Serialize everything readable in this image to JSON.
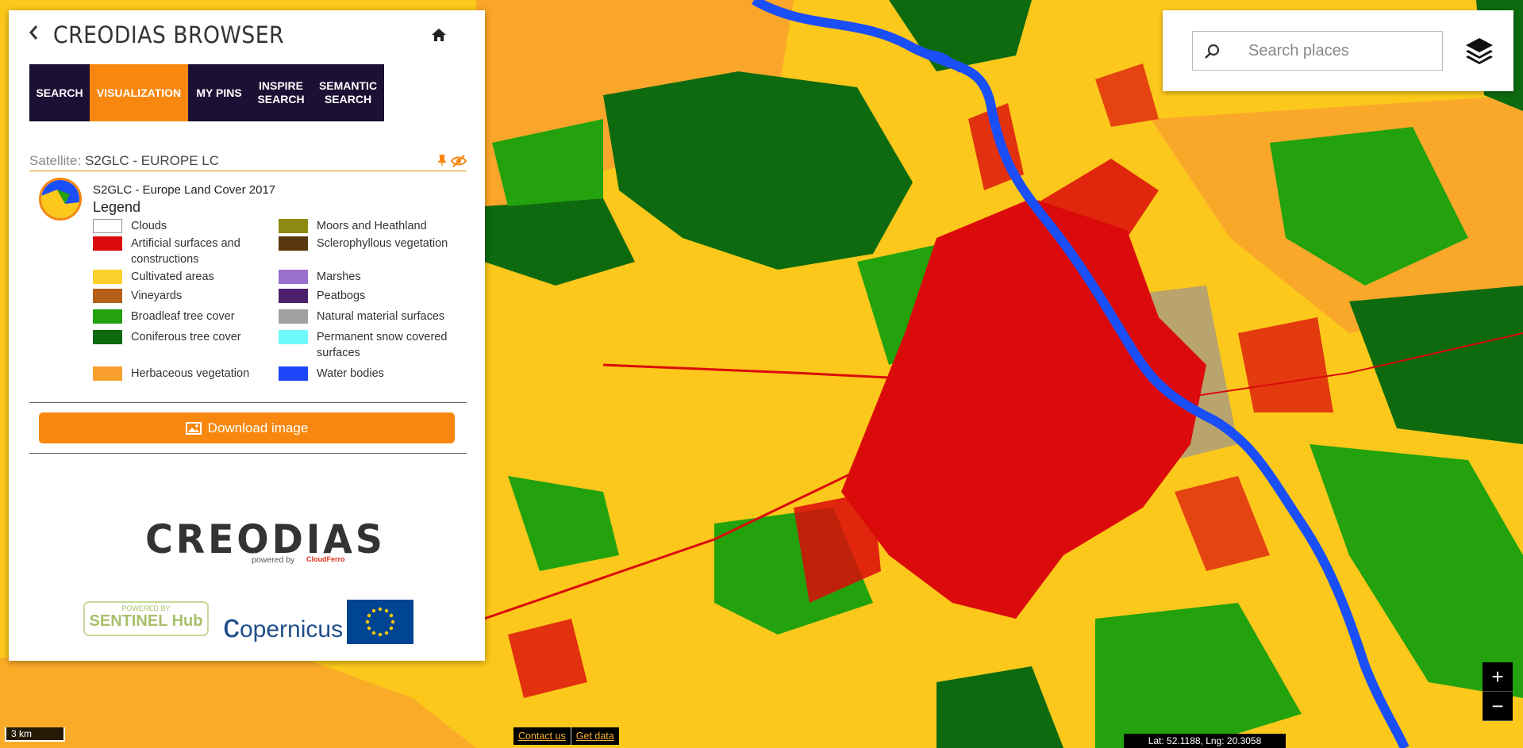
{
  "map": {
    "colors": {
      "cultivated": "#fcc81b",
      "herbaceous": "#f9a02e",
      "broadleaf": "#23a20e",
      "coniferous": "#0d6a0e",
      "artificial": "#db0b0b",
      "water": "#1a4ef7",
      "natural": "#8c8ea4"
    }
  },
  "panel": {
    "title": "CREODIAS BROWSER",
    "tabs": [
      {
        "label": "SEARCH",
        "active": false
      },
      {
        "label": "VISUALIZATION",
        "active": true
      },
      {
        "label": "MY PINS",
        "active": false
      },
      {
        "label": "INSPIRE\nSEARCH",
        "active": false
      },
      {
        "label": "SEMANTIC\nSEARCH",
        "active": false
      }
    ],
    "satellite_label": "Satellite:",
    "satellite_value": "S2GLC - EUROPE LC",
    "layer_title": "S2GLC - Europe Land Cover 2017",
    "legend_title": "Legend",
    "legend": [
      {
        "label": "Clouds",
        "color": "#ffffff"
      },
      {
        "label": "Artificial surfaces and constructions",
        "color": "#db0b0b"
      },
      {
        "label": "Cultivated areas",
        "color": "#fcd12c"
      },
      {
        "label": "Vineyards",
        "color": "#b55f19"
      },
      {
        "label": "Broadleaf tree cover",
        "color": "#23a20e"
      },
      {
        "label": "Coniferous tree cover",
        "color": "#0d6a0e"
      },
      {
        "label": "Herbaceous vegetation",
        "color": "#f9a02e"
      },
      {
        "label": "Moors and Heathland",
        "color": "#8c8a10"
      },
      {
        "label": "Sclerophyllous vegetation",
        "color": "#5b370d"
      },
      {
        "label": "Marshes",
        "color": "#9a6fcd"
      },
      {
        "label": "Peatbogs",
        "color": "#4b1f6b"
      },
      {
        "label": "Natural material surfaces",
        "color": "#a0a0a0"
      },
      {
        "label": "Permanent snow covered surfaces",
        "color": "#6ff9fb"
      },
      {
        "label": "Water bodies",
        "color": "#1c46f7"
      }
    ],
    "download_label": "Download image",
    "brand": "CREODIAS",
    "powered_by": "powered by",
    "cloudferro": "CloudFerro",
    "sentinel_top": "POWERED BY",
    "sentinel_bottom": "SENTINEL Hub",
    "copernicus": "opernicus"
  },
  "search": {
    "placeholder": "Search places"
  },
  "zoom": {
    "in": "+",
    "out": "−"
  },
  "scale_label": "3 km",
  "footer": {
    "contact": "Contact us",
    "get_data": "Get data"
  },
  "coords": "Lat: 52.1188, Lng: 20.3058"
}
